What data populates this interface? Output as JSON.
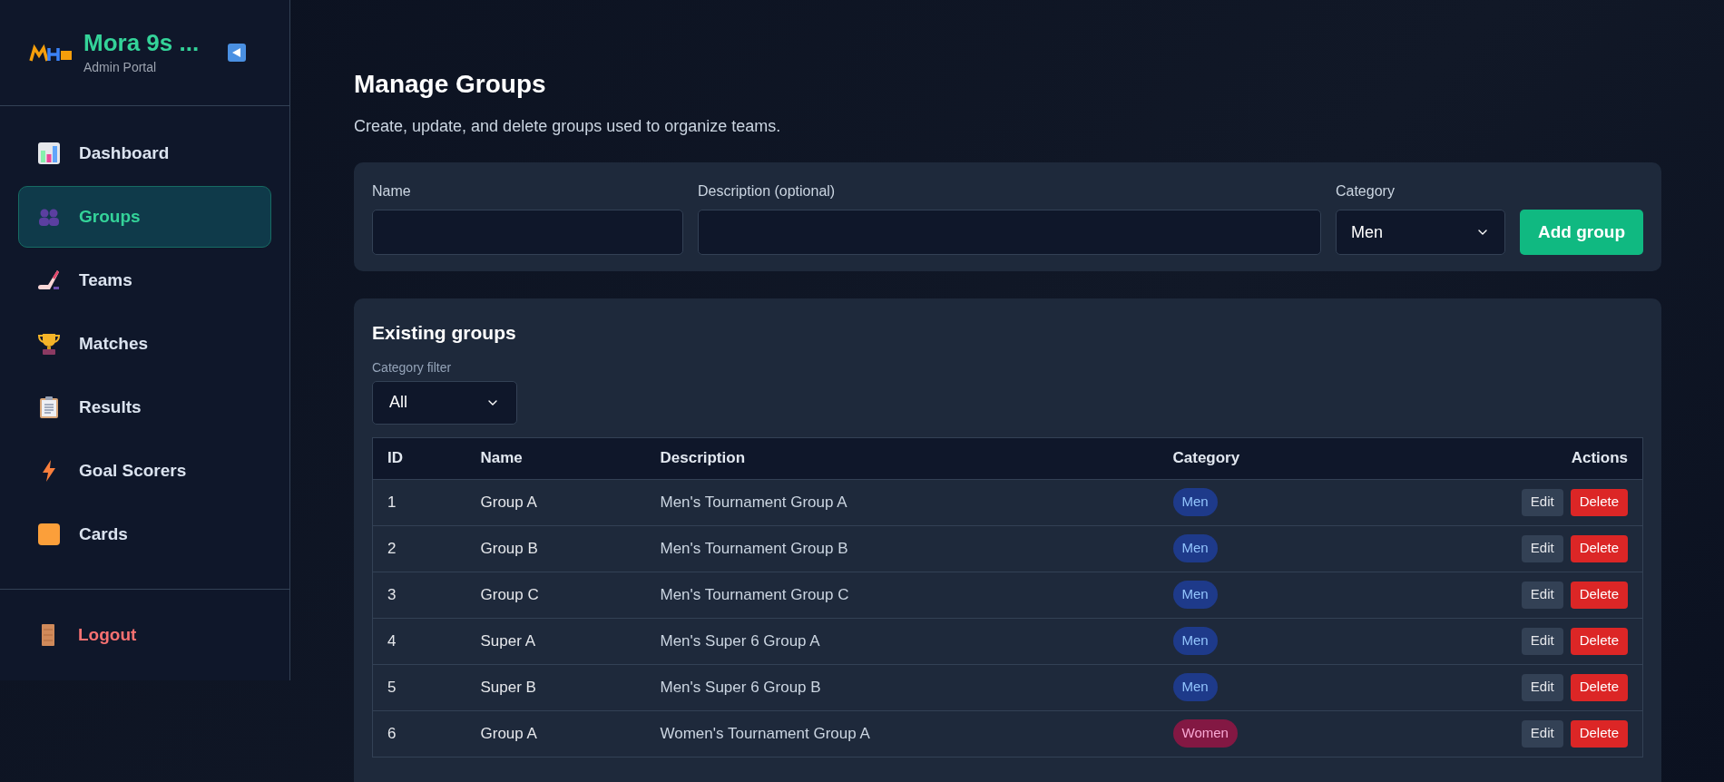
{
  "brand": {
    "title": "Mora 9s ...",
    "subtitle": "Admin Portal"
  },
  "sidebar": {
    "items": [
      {
        "label": "Dashboard",
        "kind": "chart",
        "selected": false
      },
      {
        "label": "Groups",
        "kind": "people",
        "selected": true
      },
      {
        "label": "Teams",
        "kind": "stick",
        "selected": false
      },
      {
        "label": "Matches",
        "kind": "trophy",
        "selected": false
      },
      {
        "label": "Results",
        "kind": "clipboard",
        "selected": false
      },
      {
        "label": "Goal Scorers",
        "kind": "bolt",
        "selected": false
      },
      {
        "label": "Cards",
        "kind": "card",
        "selected": false
      }
    ],
    "logout": "Logout"
  },
  "page": {
    "title": "Manage Groups",
    "subtitle": "Create, update, and delete groups used to organize teams."
  },
  "form": {
    "name_label": "Name",
    "description_label": "Description (optional)",
    "category_label": "Category",
    "category_value": "Men",
    "submit": "Add group"
  },
  "list": {
    "title": "Existing groups",
    "filter_label": "Category filter",
    "filter_value": "All",
    "columns": [
      "ID",
      "Name",
      "Description",
      "Category",
      "Actions"
    ],
    "rows": [
      {
        "id": "1",
        "name": "Group A",
        "description": "Men's Tournament Group A",
        "category": "Men",
        "kind": "men",
        "edit": "Edit",
        "delete": "Delete"
      },
      {
        "id": "2",
        "name": "Group B",
        "description": "Men's Tournament Group B",
        "category": "Men",
        "kind": "men",
        "edit": "Edit",
        "delete": "Delete"
      },
      {
        "id": "3",
        "name": "Group C",
        "description": "Men's Tournament Group C",
        "category": "Men",
        "kind": "men",
        "edit": "Edit",
        "delete": "Delete"
      },
      {
        "id": "4",
        "name": "Super A",
        "description": "Men's Super 6 Group A",
        "category": "Men",
        "kind": "men",
        "edit": "Edit",
        "delete": "Delete"
      },
      {
        "id": "5",
        "name": "Super B",
        "description": "Men's Super 6 Group B",
        "category": "Men",
        "kind": "men",
        "edit": "Edit",
        "delete": "Delete"
      },
      {
        "id": "6",
        "name": "Group A",
        "description": "Women's Tournament Group A",
        "category": "Women",
        "kind": "women",
        "edit": "Edit",
        "delete": "Delete"
      }
    ]
  }
}
